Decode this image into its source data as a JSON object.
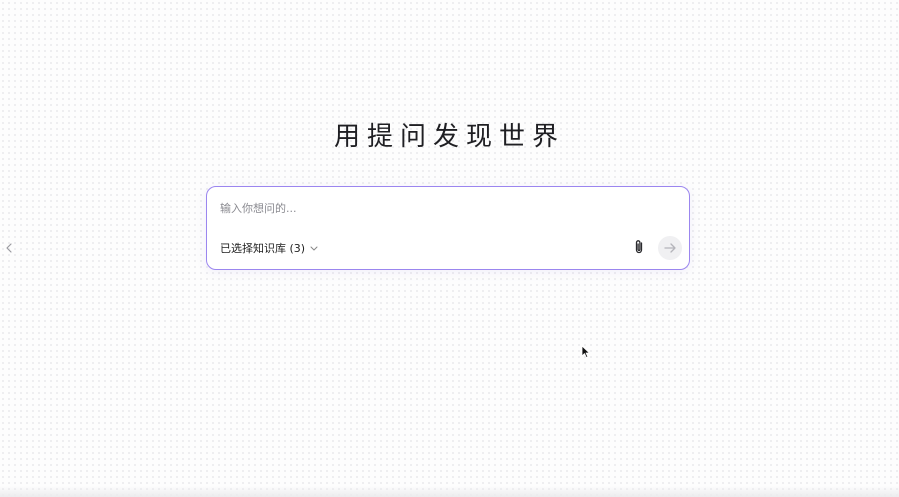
{
  "headline": "用提问发现世界",
  "chat": {
    "placeholder": "输入你想问的...",
    "knowledge_base_label": "已选择知识库 (3)"
  },
  "icons": {
    "sidebar_toggle": "chevron-left-icon",
    "kb_dropdown": "chevron-down-icon",
    "attach": "paperclip-icon",
    "send": "arrow-right-icon",
    "cursor": "mouse-pointer-icon"
  },
  "colors": {
    "accent_border": "#9b86ef",
    "send_bg": "#f0f0f2"
  }
}
